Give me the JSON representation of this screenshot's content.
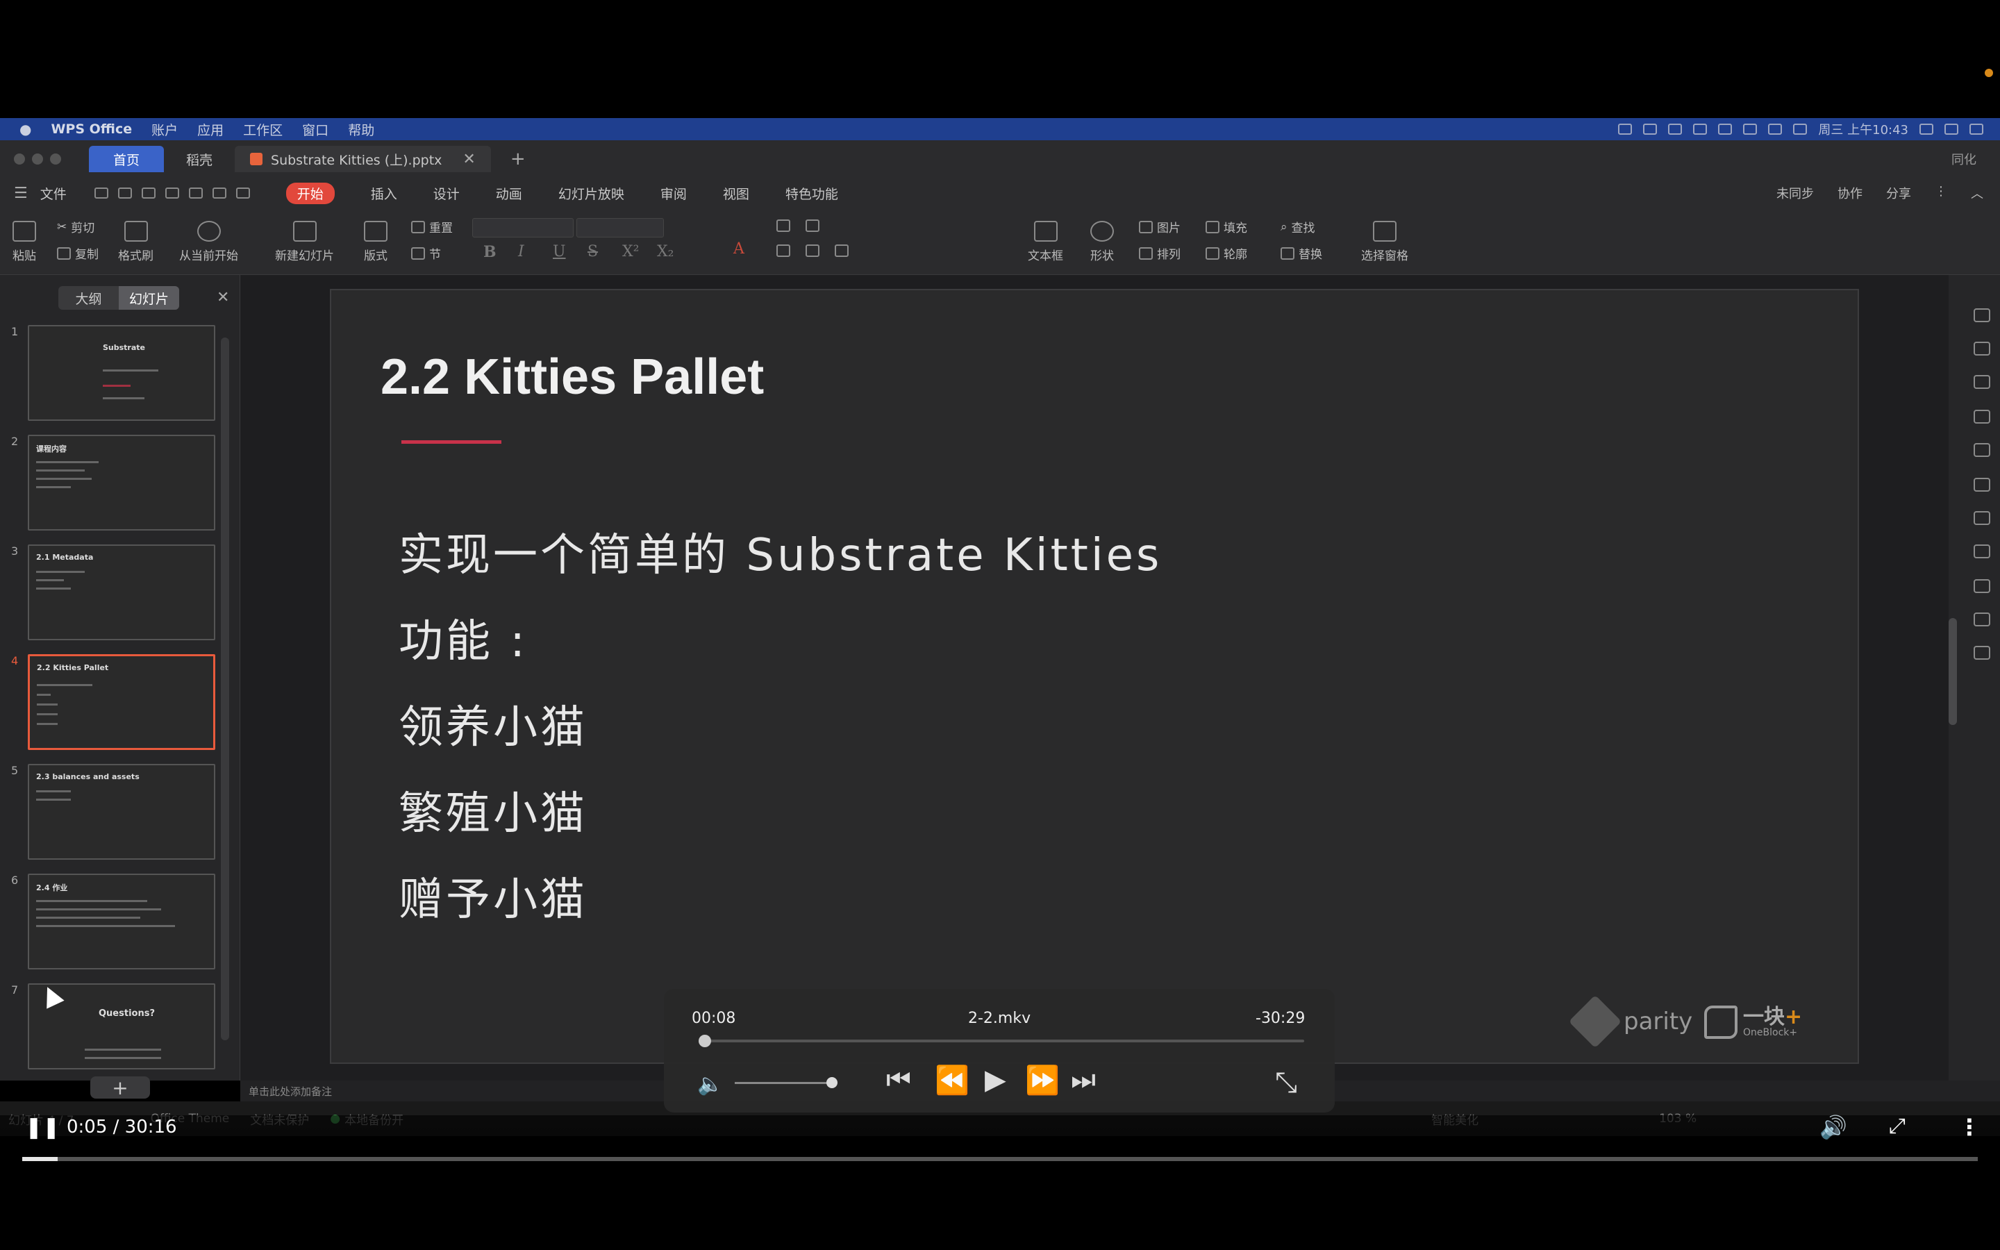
{
  "menubar": {
    "app": "WPS Office",
    "items": [
      "账户",
      "应用",
      "工作区",
      "窗口",
      "帮助"
    ],
    "clock": "周三 上午10:43"
  },
  "tabs": {
    "home": "首页",
    "draft": "稻壳",
    "doc": "Substrate Kitties (上).pptx",
    "right_user": "同化"
  },
  "menu": {
    "file": "文件",
    "tabs": [
      "开始",
      "插入",
      "设计",
      "动画",
      "幻灯片放映",
      "审阅",
      "视图",
      "特色功能"
    ],
    "right": [
      "未同步",
      "协作",
      "分享"
    ]
  },
  "ribbon": {
    "paste": "粘贴",
    "cut": "剪切",
    "copy": "复制",
    "format_painter": "格式刷",
    "from_current": "从当前开始",
    "new_slide": "新建幻灯片",
    "layout": "版式",
    "reset": "重置",
    "section": "节",
    "textbox": "文本框",
    "shape": "形状",
    "picture": "图片",
    "arrange": "排列",
    "fill": "填充",
    "outline": "轮廓",
    "find": "查找",
    "replace": "替换",
    "select_pane": "选择窗格"
  },
  "left_panel": {
    "outline_tab": "大纲",
    "slides_tab": "幻灯片",
    "slides": [
      {
        "num": "1",
        "title": "Substrate"
      },
      {
        "num": "2",
        "title": "课程内容"
      },
      {
        "num": "3",
        "title": "2.1 Metadata"
      },
      {
        "num": "4",
        "title": "2.2 Kitties Pallet"
      },
      {
        "num": "5",
        "title": "2.3 balances and assets"
      },
      {
        "num": "6",
        "title": "2.4 作业"
      },
      {
        "num": "7",
        "title": "Questions?"
      }
    ]
  },
  "slide": {
    "title": "2.2 Kitties Pallet",
    "bullets": [
      "实现一个简单的 Substrate Kitties",
      "功能 :",
      "领养小猫",
      "繁殖小猫",
      "赠予小猫"
    ],
    "logo_parity": "parity",
    "logo_oneblock": "一块",
    "logo_oneblock_sub": "OneBlock+"
  },
  "notes_placeholder": "单击此处添加备注",
  "statusbar": {
    "slide_info": "幻灯片 4 / 7",
    "theme": "Office Theme",
    "protect": "文档未保护",
    "backup": "本地备份开",
    "beautify": "智能美化",
    "zoom": "103 %"
  },
  "overlay_player": {
    "elapsed": "00:08",
    "filename": "2-2.mkv",
    "remaining": "-30:29",
    "progress": 0.005
  },
  "video_player": {
    "time": "0:05 / 30:16",
    "progress": 0.018
  }
}
